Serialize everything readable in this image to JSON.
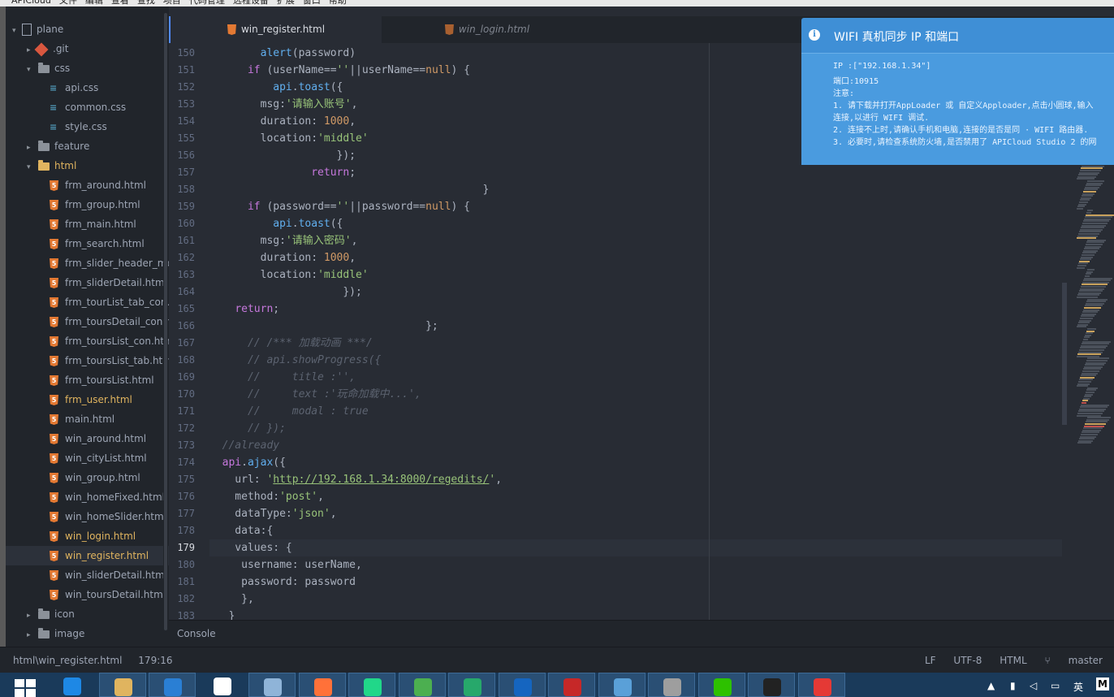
{
  "menubar": {
    "items": [
      "APICloud",
      "文件",
      "编辑",
      "查看",
      "查找",
      "项目",
      "代码管理",
      "远程设备",
      "扩展",
      "窗口",
      "帮助"
    ]
  },
  "tree": [
    {
      "label": "plane",
      "depth": 0,
      "kind": "project",
      "arrow": "open"
    },
    {
      "label": ".git",
      "depth": 1,
      "kind": "git",
      "arrow": "closed"
    },
    {
      "label": "css",
      "depth": 1,
      "kind": "folder",
      "arrow": "open"
    },
    {
      "label": "api.css",
      "depth": 2,
      "kind": "css"
    },
    {
      "label": "common.css",
      "depth": 2,
      "kind": "css"
    },
    {
      "label": "style.css",
      "depth": 2,
      "kind": "css"
    },
    {
      "label": "feature",
      "depth": 1,
      "kind": "folder",
      "arrow": "closed"
    },
    {
      "label": "html",
      "depth": 1,
      "kind": "folder-open",
      "arrow": "open",
      "modified": true
    },
    {
      "label": "frm_around.html",
      "depth": 2,
      "kind": "html"
    },
    {
      "label": "frm_group.html",
      "depth": 2,
      "kind": "html"
    },
    {
      "label": "frm_main.html",
      "depth": 2,
      "kind": "html"
    },
    {
      "label": "frm_search.html",
      "depth": 2,
      "kind": "html"
    },
    {
      "label": "frm_slider_header_me",
      "depth": 2,
      "kind": "html"
    },
    {
      "label": "frm_sliderDetail.html",
      "depth": 2,
      "kind": "html"
    },
    {
      "label": "frm_tourList_tab_con.",
      "depth": 2,
      "kind": "html"
    },
    {
      "label": "frm_toursDetail_con.h",
      "depth": 2,
      "kind": "html"
    },
    {
      "label": "frm_toursList_con.htm",
      "depth": 2,
      "kind": "html"
    },
    {
      "label": "frm_toursList_tab.htm",
      "depth": 2,
      "kind": "html"
    },
    {
      "label": "frm_toursList.html",
      "depth": 2,
      "kind": "html"
    },
    {
      "label": "frm_user.html",
      "depth": 2,
      "kind": "html",
      "modified": true
    },
    {
      "label": "main.html",
      "depth": 2,
      "kind": "html"
    },
    {
      "label": "win_around.html",
      "depth": 2,
      "kind": "html"
    },
    {
      "label": "win_cityList.html",
      "depth": 2,
      "kind": "html"
    },
    {
      "label": "win_group.html",
      "depth": 2,
      "kind": "html"
    },
    {
      "label": "win_homeFixed.html",
      "depth": 2,
      "kind": "html"
    },
    {
      "label": "win_homeSlider.html",
      "depth": 2,
      "kind": "html"
    },
    {
      "label": "win_login.html",
      "depth": 2,
      "kind": "html",
      "modified": true
    },
    {
      "label": "win_register.html",
      "depth": 2,
      "kind": "html",
      "modified": true,
      "selected": true
    },
    {
      "label": "win_sliderDetail.html",
      "depth": 2,
      "kind": "html"
    },
    {
      "label": "win_toursDetail.html",
      "depth": 2,
      "kind": "html"
    },
    {
      "label": "icon",
      "depth": 1,
      "kind": "folder",
      "arrow": "closed"
    },
    {
      "label": "image",
      "depth": 1,
      "kind": "folder",
      "arrow": "closed"
    }
  ],
  "tabs": [
    {
      "label": "win_register.html",
      "active": true
    },
    {
      "label": "win_login.html",
      "active": false
    }
  ],
  "editor": {
    "current_line": 179,
    "lines": [
      {
        "n": 150,
        "segs": [
          [
            "p",
            "        "
          ],
          [
            "f",
            "alert"
          ],
          [
            "p",
            "(password)"
          ]
        ]
      },
      {
        "n": 151,
        "segs": [
          [
            "p",
            "      "
          ],
          [
            "k",
            "if"
          ],
          [
            "p",
            " (userName=="
          ],
          [
            "s",
            "''"
          ],
          [
            "p",
            "||userName=="
          ],
          [
            "n",
            "null"
          ],
          [
            "p",
            ") {"
          ]
        ]
      },
      {
        "n": 152,
        "segs": [
          [
            "p",
            "          "
          ],
          [
            "f",
            "api"
          ],
          [
            "p",
            "."
          ],
          [
            "f",
            "toast"
          ],
          [
            "p",
            "({"
          ]
        ]
      },
      {
        "n": 153,
        "segs": [
          [
            "p",
            "        msg:"
          ],
          [
            "s",
            "'请输入账号'"
          ],
          [
            "p",
            ","
          ]
        ]
      },
      {
        "n": 154,
        "segs": [
          [
            "p",
            "        duration: "
          ],
          [
            "n",
            "1000"
          ],
          [
            "p",
            ","
          ]
        ]
      },
      {
        "n": 155,
        "segs": [
          [
            "p",
            "        location:"
          ],
          [
            "s",
            "'middle'"
          ]
        ]
      },
      {
        "n": 156,
        "segs": [
          [
            "p",
            "                    });"
          ]
        ]
      },
      {
        "n": 157,
        "segs": [
          [
            "p",
            "                "
          ],
          [
            "k",
            "return"
          ],
          [
            "p",
            ";"
          ]
        ]
      },
      {
        "n": 158,
        "segs": [
          [
            "p",
            "                                           }"
          ]
        ]
      },
      {
        "n": 159,
        "segs": [
          [
            "p",
            "      "
          ],
          [
            "k",
            "if"
          ],
          [
            "p",
            " (password=="
          ],
          [
            "s",
            "''"
          ],
          [
            "p",
            "||password=="
          ],
          [
            "n",
            "null"
          ],
          [
            "p",
            ") {"
          ]
        ]
      },
      {
        "n": 160,
        "segs": [
          [
            "p",
            "          "
          ],
          [
            "f",
            "api"
          ],
          [
            "p",
            "."
          ],
          [
            "f",
            "toast"
          ],
          [
            "p",
            "({"
          ]
        ]
      },
      {
        "n": 161,
        "segs": [
          [
            "p",
            "        msg:"
          ],
          [
            "s",
            "'请输入密码'"
          ],
          [
            "p",
            ","
          ]
        ]
      },
      {
        "n": 162,
        "segs": [
          [
            "p",
            "        duration: "
          ],
          [
            "n",
            "1000"
          ],
          [
            "p",
            ","
          ]
        ]
      },
      {
        "n": 163,
        "segs": [
          [
            "p",
            "        location:"
          ],
          [
            "s",
            "'middle'"
          ]
        ]
      },
      {
        "n": 164,
        "segs": [
          [
            "p",
            "                     });"
          ]
        ]
      },
      {
        "n": 165,
        "segs": [
          [
            "p",
            "    "
          ],
          [
            "k",
            "return"
          ],
          [
            "p",
            ";"
          ]
        ]
      },
      {
        "n": 166,
        "segs": [
          [
            "p",
            "                                  };"
          ]
        ]
      },
      {
        "n": 167,
        "segs": [
          [
            "c",
            "      // /*** 加载动画 ***/"
          ]
        ]
      },
      {
        "n": 168,
        "segs": [
          [
            "c",
            "      // api.showProgress({"
          ]
        ]
      },
      {
        "n": 169,
        "segs": [
          [
            "c",
            "      //     title :'',"
          ]
        ]
      },
      {
        "n": 170,
        "segs": [
          [
            "c",
            "      //     text :'玩命加载中...',"
          ]
        ]
      },
      {
        "n": 171,
        "segs": [
          [
            "c",
            "      //     modal : true"
          ]
        ]
      },
      {
        "n": 172,
        "segs": [
          [
            "c",
            "      // });"
          ]
        ]
      },
      {
        "n": 173,
        "segs": [
          [
            "c",
            "  //already"
          ]
        ]
      },
      {
        "n": 174,
        "segs": [
          [
            "p",
            "  "
          ],
          [
            "k",
            "api"
          ],
          [
            "p",
            "."
          ],
          [
            "f",
            "ajax"
          ],
          [
            "p",
            "({"
          ]
        ]
      },
      {
        "n": 175,
        "segs": [
          [
            "p",
            "    url: "
          ],
          [
            "s",
            "'"
          ],
          [
            "u",
            "http://192.168.1.34:8000/regedits/"
          ],
          [
            "s",
            "'"
          ],
          [
            "p",
            ","
          ]
        ]
      },
      {
        "n": 176,
        "segs": [
          [
            "p",
            "    method:"
          ],
          [
            "s",
            "'post'"
          ],
          [
            "p",
            ","
          ]
        ]
      },
      {
        "n": 177,
        "segs": [
          [
            "p",
            "    dataType:"
          ],
          [
            "s",
            "'json'"
          ],
          [
            "p",
            ","
          ]
        ]
      },
      {
        "n": 178,
        "segs": [
          [
            "p",
            "    data:{"
          ]
        ]
      },
      {
        "n": 179,
        "segs": [
          [
            "p",
            "    values: {"
          ]
        ]
      },
      {
        "n": 180,
        "segs": [
          [
            "p",
            "     username: userName,"
          ]
        ]
      },
      {
        "n": 181,
        "segs": [
          [
            "p",
            "     password: password"
          ]
        ]
      },
      {
        "n": 182,
        "segs": [
          [
            "p",
            "     },"
          ]
        ]
      },
      {
        "n": 183,
        "segs": [
          [
            "p",
            "   }"
          ]
        ]
      }
    ]
  },
  "console": {
    "label": "Console"
  },
  "status": {
    "path": "html\\win_register.html",
    "cursor": "179:16",
    "line_ending": "LF",
    "encoding": "UTF-8",
    "grammar": "HTML",
    "branch": "master"
  },
  "notification": {
    "title": "WIFI 真机同步 IP 和端口",
    "lines": [
      "IP  :[\"192.168.1.34\"]",
      "端口:10915",
      "注意:",
      "1. 请下载并打开AppLoader 或 自定义Apploader,点击小圆球,输入",
      "连接,以进行 WIFI 调试.",
      "2. 连接不上时,请确认手机和电脑,连接的是否是同 · WIFI 路由器.",
      "3. 必要时,请检查系统防火墙,是否禁用了 APICloud Studio 2 的网"
    ]
  },
  "taskbar": {
    "apps": [
      "ie-icon",
      "explorer-icon",
      "baidu-netdisk-icon",
      "file-icon",
      "monitor-icon",
      "firefox-icon",
      "pycharm-icon",
      "chrome-icon",
      "cloud-icon",
      "security-icon",
      "wps-icon",
      "dolphin-icon",
      "settings-icon",
      "wechat-icon",
      "cmd-icon",
      "camera-icon"
    ],
    "ime": "英",
    "ime_mode": "M"
  }
}
